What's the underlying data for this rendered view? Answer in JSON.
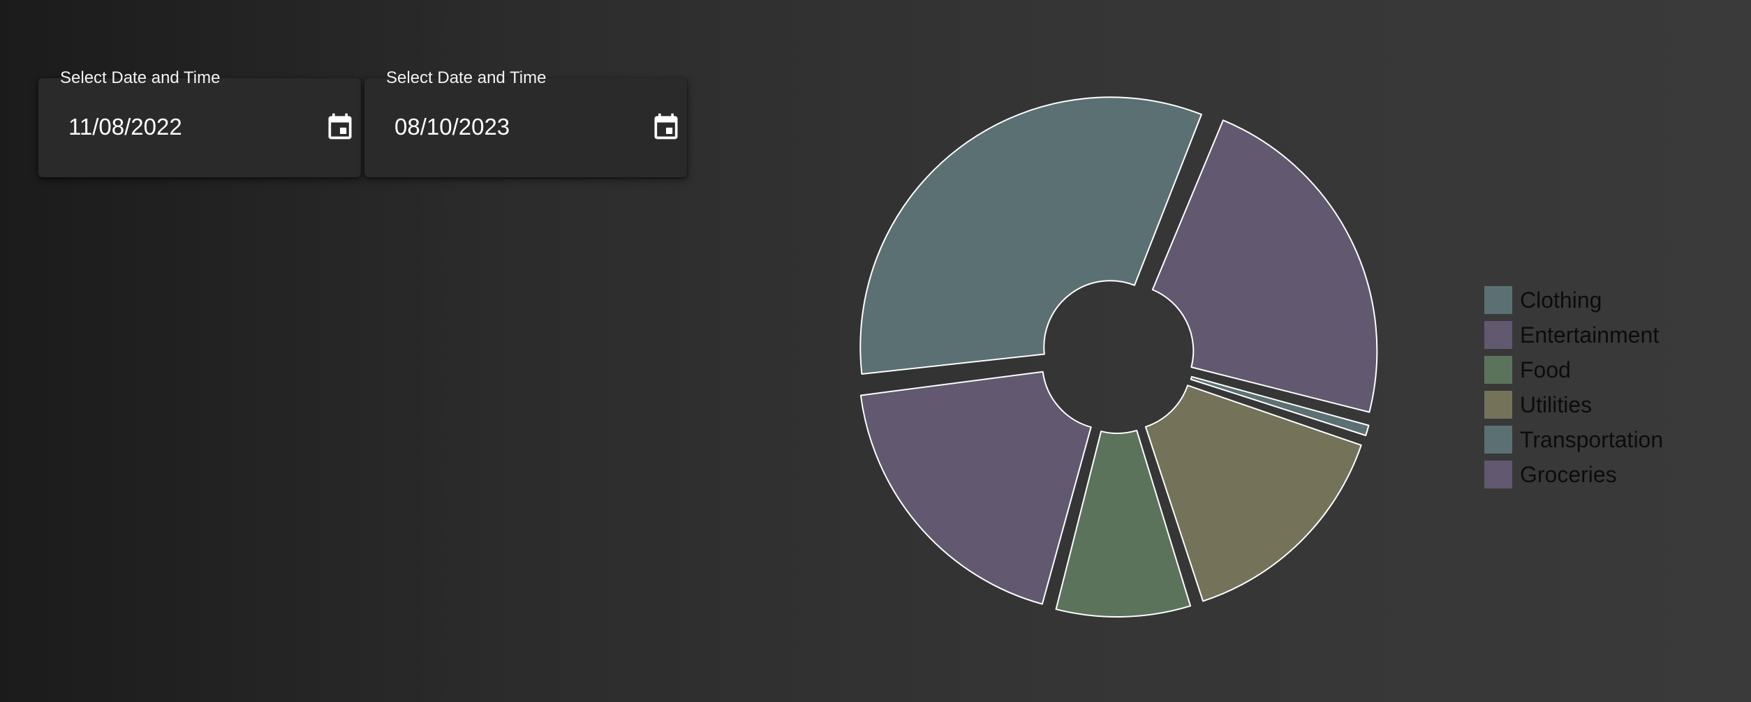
{
  "date_pickers": [
    {
      "label": "Select Date and Time",
      "value": "11/08/2022",
      "icon": "calendar-icon"
    },
    {
      "label": "Select Date and Time",
      "value": "08/10/2023",
      "icon": "calendar-icon"
    }
  ],
  "colors": {
    "slate": "#5b7073",
    "purple": "#625870",
    "green": "#5c735b",
    "olive": "#747259",
    "slice_border": "#ffffff",
    "legend_text": "#0c0c0c"
  },
  "chart_data": {
    "type": "pie",
    "donut": true,
    "exploded": true,
    "categories": [
      "Clothing",
      "Entertainment",
      "Food",
      "Utilities",
      "Transportation",
      "Groceries"
    ],
    "values": [
      33,
      19,
      9,
      15,
      1,
      23
    ],
    "series_colors": [
      "#5b7073",
      "#625870",
      "#5c735b",
      "#747259",
      "#5b7073",
      "#625870"
    ],
    "legend": {
      "position": "right",
      "items": [
        {
          "label": "Clothing",
          "color": "#5b7073"
        },
        {
          "label": "Entertainment",
          "color": "#625870"
        },
        {
          "label": "Food",
          "color": "#5c735b"
        },
        {
          "label": "Utilities",
          "color": "#747259"
        },
        {
          "label": "Transportation",
          "color": "#5b7073"
        },
        {
          "label": "Groceries",
          "color": "#625870"
        }
      ]
    }
  }
}
